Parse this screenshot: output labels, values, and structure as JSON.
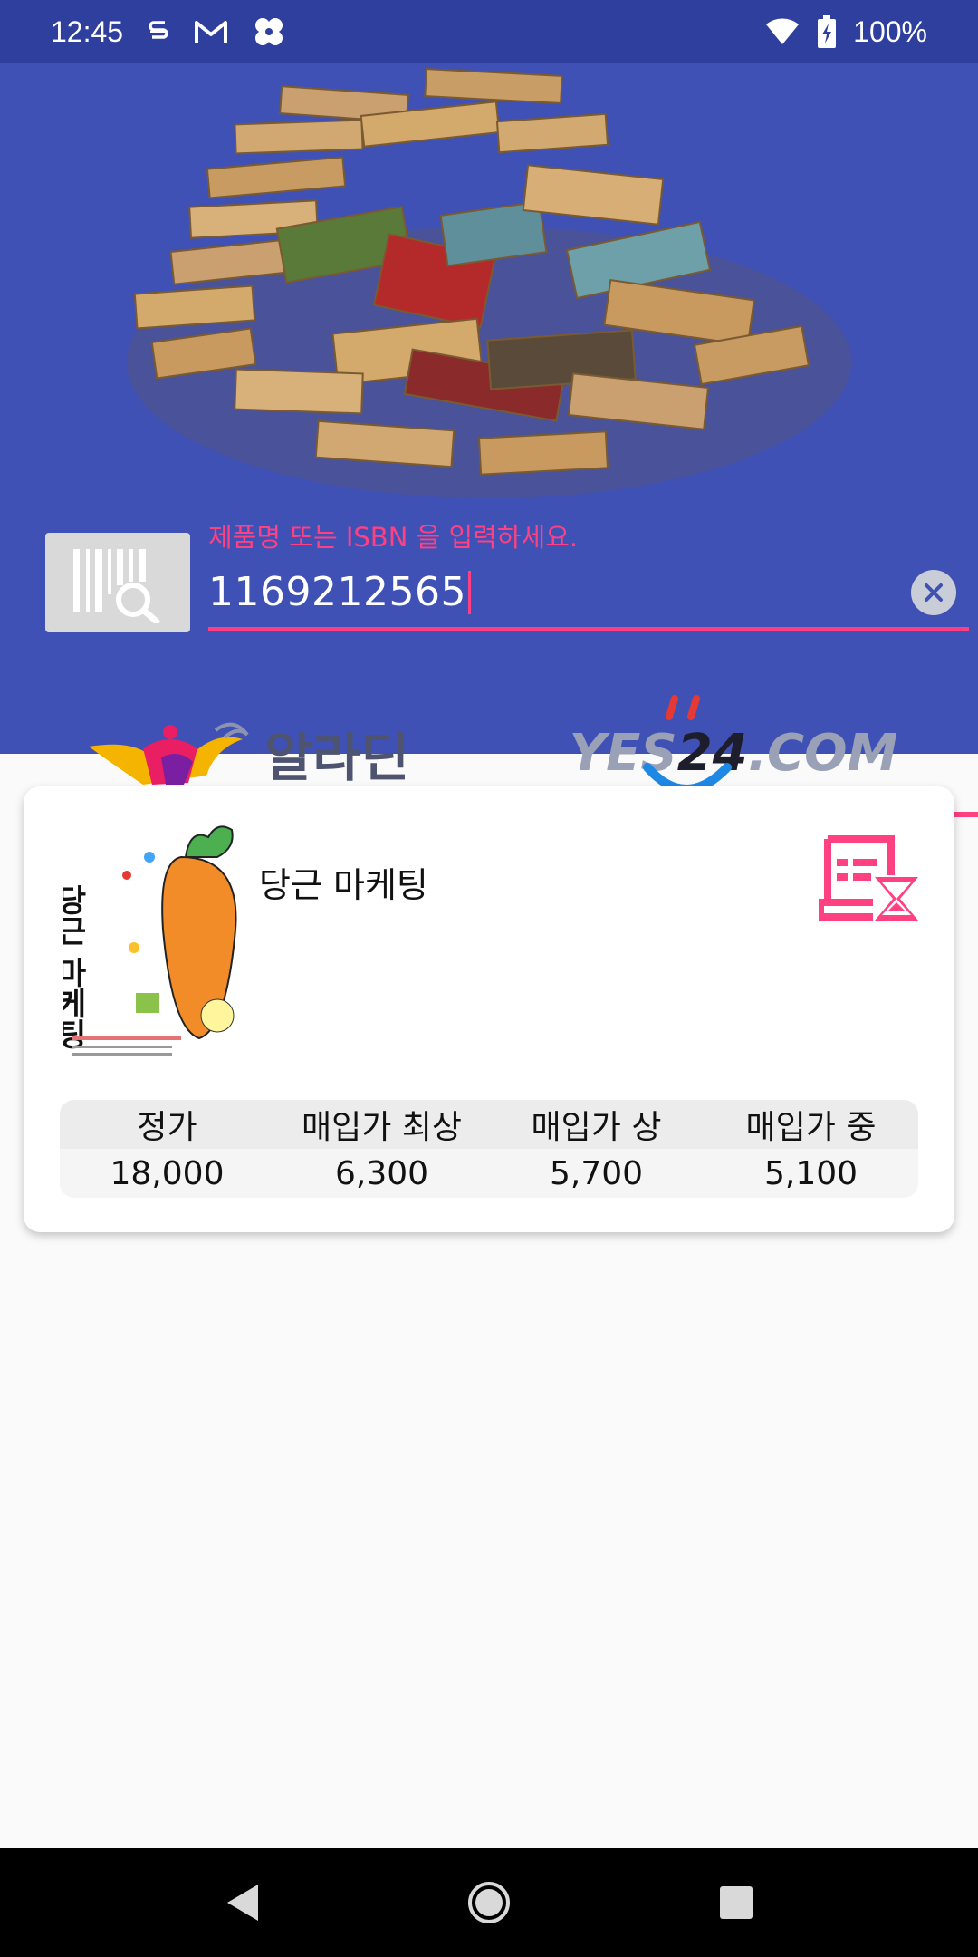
{
  "status_bar": {
    "time": "12:45",
    "battery": "100%",
    "icons": [
      "s-icon",
      "gmail-icon",
      "pinwheel-icon",
      "wifi-icon",
      "battery-charging-icon"
    ]
  },
  "search": {
    "hint": "제품명 또는 ISBN 을 입력하세요.",
    "value": "1169212565",
    "accent_color": "#ff4081"
  },
  "tabs": {
    "aladin_label": "알라딘",
    "yes24_prefix": "YES",
    "yes24_number": "24",
    "yes24_suffix": ".COM",
    "selected": "yes24"
  },
  "book": {
    "title": "당근 마케팅",
    "cover_title": "당근 마케팅"
  },
  "price_table": {
    "headers": [
      "정가",
      "매입가 최상",
      "매입가 상",
      "매입가 중"
    ],
    "values": [
      "18,000",
      "6,300",
      "5,700",
      "5,100"
    ]
  },
  "colors": {
    "header_bg": "#3f51b5",
    "status_bg": "#2f3f9e",
    "accent": "#ff4081"
  }
}
